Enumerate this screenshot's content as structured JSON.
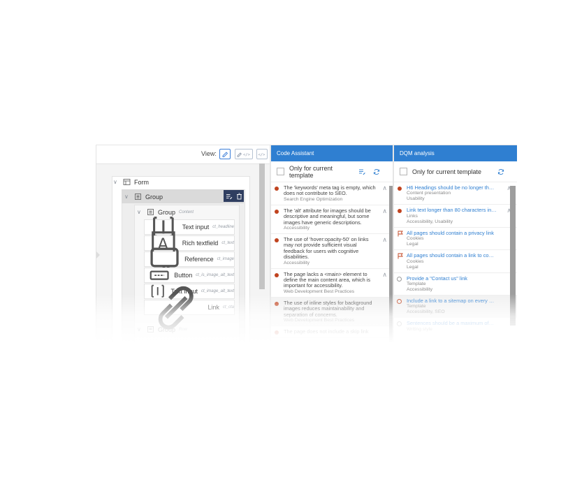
{
  "view": {
    "label": "View:",
    "modes": [
      "edit-icon",
      "edit-code-icon",
      "code-icon"
    ]
  },
  "tree": {
    "form_label": "Form",
    "group_label": "Group",
    "inner_group_label": "Group",
    "inner_group_hint": "Content",
    "fields": [
      {
        "label": "Text input",
        "hint": "ct_headline",
        "icon": "text-input-icon"
      },
      {
        "label": "Rich textfield",
        "hint": "ct_text",
        "icon": "rich-textfield-icon"
      },
      {
        "label": "Reference",
        "hint": "ct_image",
        "icon": "reference-icon"
      },
      {
        "label": "Button",
        "hint": "ct_is_image_alt_text",
        "icon": "button-icon"
      },
      {
        "label": "Text input",
        "hint": "ct_image_alt_text",
        "icon": "text-input-icon"
      },
      {
        "label": "Link",
        "hint": "ct_cta",
        "icon": "link-icon"
      }
    ],
    "trailing_group_label": "Group",
    "trailing_group_hint": "Row"
  },
  "code_assistant": {
    "title": "Code Assistant",
    "filter_label": "Only for current template",
    "issues": [
      {
        "text": "The 'keywords' meta tag is empty, which does not contribute to SEO.",
        "category": "Search Engine Optimization"
      },
      {
        "text": "The 'alt' attribute for images should be descriptive and meaningful, but some images have generic descriptions.",
        "category": "Accessibility"
      },
      {
        "text": "The use of 'hover:opacity-50' on links may not provide sufficient visual feedback for users with cognitive disabilities.",
        "category": "Accessibility"
      },
      {
        "text": "The page lacks a <main> element to define the main content area, which is important for accessibility.",
        "category": "Web Development Best Practices"
      },
      {
        "text": "The use of inline styles for background images reduces maintainability and separation of concerns.",
        "category": "Web Development Best Practices"
      },
      {
        "text": "The page does not include a skip link",
        "category": ""
      }
    ]
  },
  "dqm": {
    "title": "DQM analysis",
    "filter_label": "Only for current template",
    "issues": [
      {
        "text": "H6 Headings should be no longer th…",
        "category": "Content presentation",
        "category2": "Usability",
        "marker": "dot"
      },
      {
        "text": "Link text longer than 80 characters in…",
        "category": "Links",
        "category2": "Accessibility, Usability",
        "marker": "dot"
      },
      {
        "text": "All pages should contain a privacy link",
        "category": "Cookies",
        "category2": "Legal",
        "marker": "flag"
      },
      {
        "text": "All pages should contain a link to co…",
        "category": "Cookies",
        "category2": "Legal",
        "marker": "flag"
      },
      {
        "text": "Provide a \"Contact us\" link",
        "category": "Template",
        "category2": "Accessibility",
        "marker": "ring-grey"
      },
      {
        "text": "Include a link to a sitemap on every …",
        "category": "Template",
        "category2": "Accessibility, SEO",
        "marker": "ring"
      },
      {
        "text": "Sentences should be a maximum of…",
        "category": "Writing style",
        "category2": "",
        "marker": "ring-grey"
      }
    ]
  },
  "colors": {
    "accent": "#2f7fd1",
    "error": "#c0431f",
    "dark_action": "#2f3e60"
  }
}
